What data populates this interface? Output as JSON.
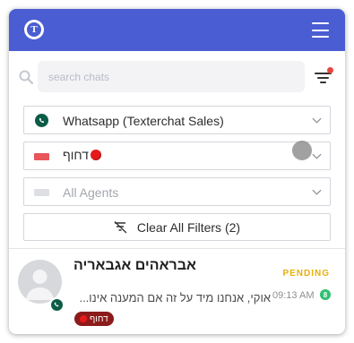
{
  "header": {
    "logo_letter": "T",
    "brand_color": "#4a5dd3"
  },
  "search": {
    "placeholder": "search chats",
    "value": ""
  },
  "filters": {
    "channel": {
      "label": "Whatsapp (Texterchat Sales)",
      "icon": "whatsapp-icon"
    },
    "tag": {
      "label": "דחוף",
      "color": "#e8555a",
      "emoji": "red-circle"
    },
    "agents": {
      "label": "All Agents"
    },
    "clear_label": "Clear All Filters (2)",
    "active_indicator_color": "#e8453c"
  },
  "chats": [
    {
      "name": "אבראהים אגבאריה",
      "status": "PENDING",
      "status_color": "#e7b00c",
      "preview": "אוקי, אנחנו מיד על זה אם המענה אינו...",
      "time": "09:13 AM",
      "unread": "8",
      "tag": "דחוף",
      "tag_color": "#8c1b1b",
      "channel_icon": "whatsapp-icon"
    }
  ]
}
